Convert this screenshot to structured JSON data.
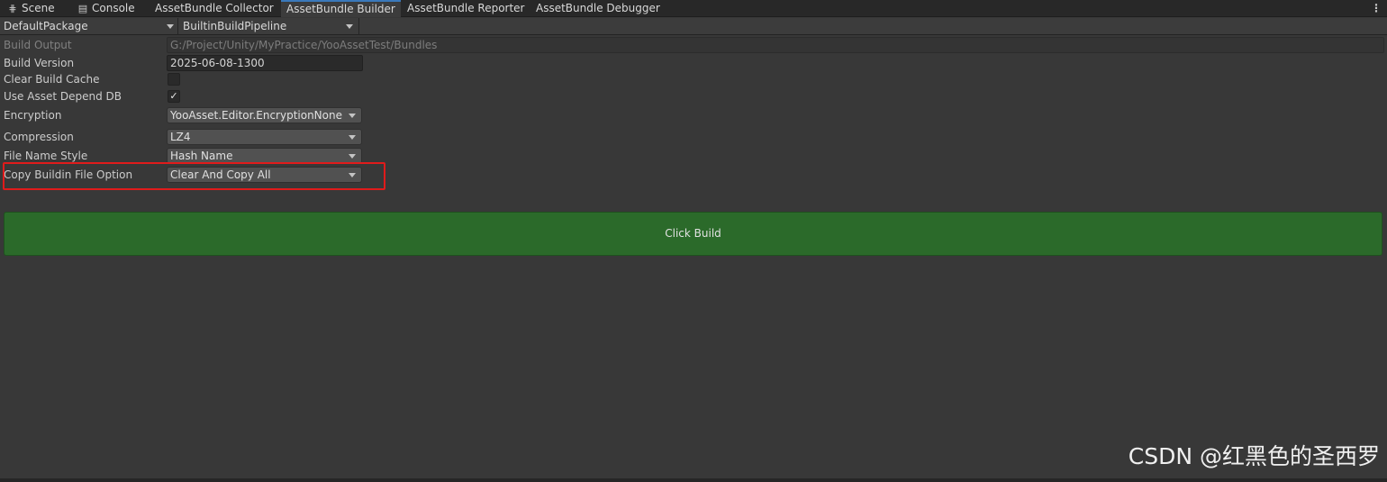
{
  "tabs": [
    {
      "label": "Scene",
      "icon": "grid-icon",
      "glyph": "⋕"
    },
    {
      "label": "Console",
      "icon": "console-icon",
      "glyph": "▤"
    },
    {
      "label": "AssetBundle Collector"
    },
    {
      "label": "AssetBundle Builder",
      "active": true
    },
    {
      "label": "AssetBundle Reporter"
    },
    {
      "label": "AssetBundle Debugger"
    }
  ],
  "more_menu_glyph": "⋮",
  "toolbar": {
    "package": "DefaultPackage",
    "pipeline": "BuiltinBuildPipeline"
  },
  "form": {
    "build_output": {
      "label": "Build Output",
      "value": "G:/Project/Unity/MyPractice/YooAssetTest/Bundles"
    },
    "build_version": {
      "label": "Build Version",
      "value": "2025-06-08-1300"
    },
    "clear_build_cache": {
      "label": "Clear Build Cache",
      "checked": false
    },
    "use_asset_depend_db": {
      "label": "Use Asset Depend DB",
      "checked": true,
      "check_glyph": "✓"
    },
    "encryption": {
      "label": "Encryption",
      "value": "YooAsset.Editor.EncryptionNone"
    },
    "compression": {
      "label": "Compression",
      "value": "LZ4"
    },
    "file_name_style": {
      "label": "File Name Style",
      "value": "Hash Name"
    },
    "copy_buildin_file_option": {
      "label": "Copy Buildin File Option",
      "value": "Clear And Copy All"
    }
  },
  "build_button": "Click Build",
  "watermark": "CSDN @红黑色的圣西罗",
  "colors": {
    "background": "#383838",
    "build_button": "#2b6a2a",
    "highlight": "#e01b1b",
    "active_tab_accent": "#3a79bb"
  }
}
